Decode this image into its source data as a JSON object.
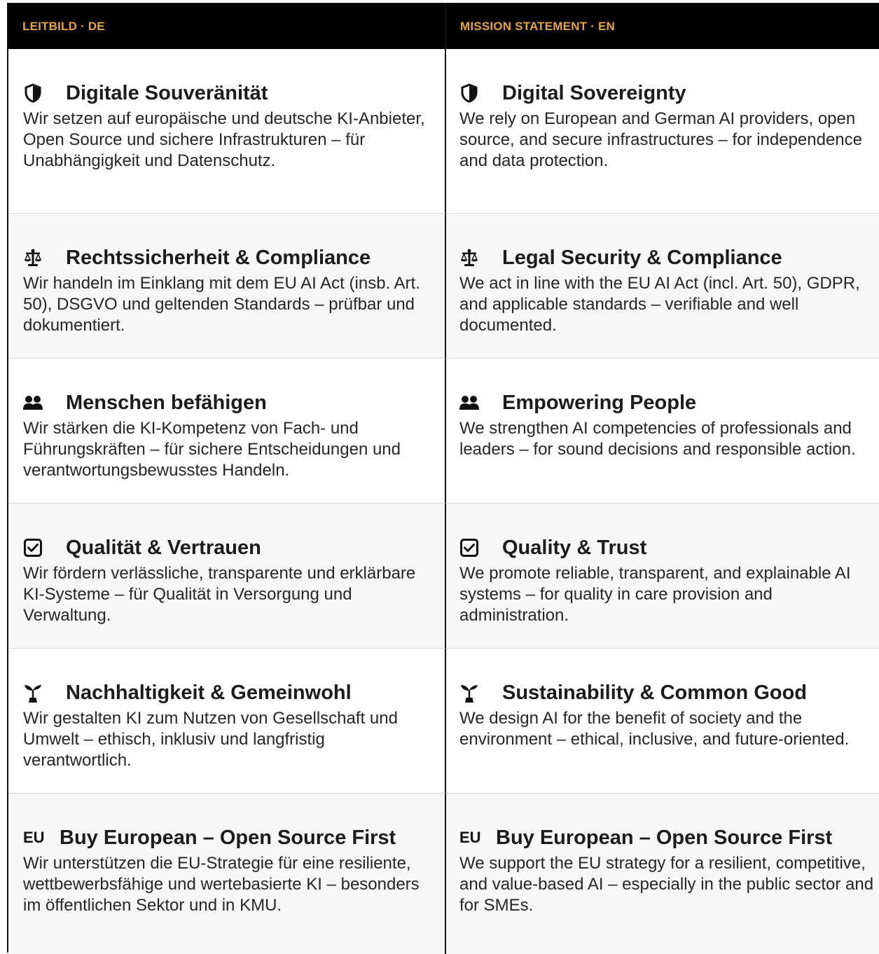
{
  "header": {
    "de": "LEITBILD · DE",
    "en": "MISSION STATEMENT · EN"
  },
  "rows": [
    {
      "icon": "shield-icon",
      "de_title": "Digitale Souveränität",
      "de_text": "Wir setzen auf europäische und deutsche KI-Anbieter, Open Source und sichere Infrastrukturen – für Unabhängigkeit und Datenschutz.",
      "en_title": "Digital Sovereignty",
      "en_text": "We rely on European and German AI providers, open source, and secure infrastructures – for independence and data protection."
    },
    {
      "icon": "scales-icon",
      "de_title": "Rechtssicherheit & Compliance",
      "de_text": "Wir handeln im Einklang mit dem EU AI Act (insb. Art. 50), DSGVO und geltenden Standards – prüfbar und dokumentiert.",
      "en_title": "Legal Security & Compliance",
      "en_text": "We act in line with the EU AI Act (incl. Art. 50), GDPR, and applicable standards – verifiable and well documented."
    },
    {
      "icon": "people-icon",
      "de_title": "Menschen befähigen",
      "de_text": "Wir stärken die KI-Kompetenz von Fach- und Führungskräften – für sichere Entscheidungen und verantwortungsbewusstes Handeln.",
      "en_title": "Empowering People",
      "en_text": "We strengthen AI competencies of professionals and leaders – for sound decisions and responsible action."
    },
    {
      "icon": "checkbox-icon",
      "de_title": "Qualität & Vertrauen",
      "de_text": "Wir fördern verlässliche, transparente und erklärbare KI-Systeme – für Qualität in Versorgung und Verwaltung.",
      "en_title": "Quality & Trust",
      "en_text": "We promote reliable, transparent, and explainable AI systems – for quality in care provision and administration."
    },
    {
      "icon": "seedling-icon",
      "de_title": "Nachhaltigkeit & Gemeinwohl",
      "de_text": "Wir gestalten KI zum Nutzen von Gesellschaft und Umwelt – ethisch, inklusiv und langfristig verantwortlich.",
      "en_title": "Sustainability & Common Good",
      "en_text": "We design AI for the benefit of society and the environment – ethical, inclusive, and future-oriented."
    },
    {
      "icon": "eu-icon",
      "icon_text": "EU",
      "de_title": "Buy European – Open Source First",
      "de_text": "Wir unterstützen die EU-Strategie für eine resiliente, wettbewerbsfähige und wertebasierte KI – besonders im öffentlichen Sektor und in KMU.",
      "en_title": "Buy European – Open Source First",
      "en_text": "We support the EU strategy for a resilient, competitive, and value-based AI – especially in the public sector and for SMEs."
    }
  ]
}
